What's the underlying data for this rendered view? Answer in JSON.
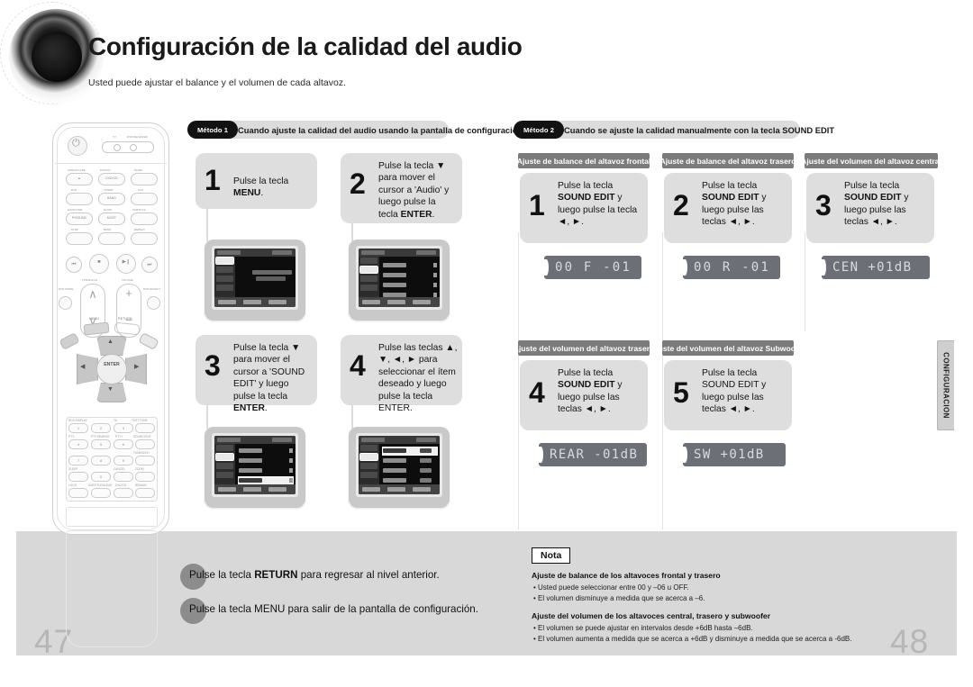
{
  "header": {
    "title": "Configuración de la calidad del audio",
    "subtitle": "Usted puede ajustar el balance y el volumen de cada altavoz.",
    "speaker_icon": "speaker-cone-icon"
  },
  "side_tab": {
    "label": "CONFIGURACION"
  },
  "pages": {
    "left": "47",
    "right": "48"
  },
  "method1": {
    "badge": "Método 1",
    "heading": "Cuando ajuste la calidad del audio usando la pantalla de configuración",
    "steps": [
      {
        "num": "1",
        "text_parts": [
          {
            "t": "Pulse la tecla ",
            "b": false
          },
          {
            "t": "MENU",
            "b": true
          },
          {
            "t": ".",
            "b": false
          }
        ]
      },
      {
        "num": "2",
        "text_parts": [
          {
            "t": "Pulse la tecla ▼ para mover el cursor a 'Audio' y luego pulse la tecla ",
            "b": false
          },
          {
            "t": "ENTER",
            "b": true
          },
          {
            "t": ".",
            "b": false
          }
        ]
      },
      {
        "num": "3",
        "text_parts": [
          {
            "t": "Pulse la tecla ▼ para mover el cursor a 'SOUND EDIT' y luego pulse la tecla ",
            "b": false
          },
          {
            "t": "ENTER",
            "b": true
          },
          {
            "t": ".",
            "b": false
          }
        ]
      },
      {
        "num": "4",
        "text_parts": [
          {
            "t": "Pulse las teclas ▲, ▼, ◄, ► para seleccionar el ítem deseado y luego pulse la tecla ENTER.",
            "b": false
          }
        ]
      }
    ]
  },
  "method2": {
    "badge": "Método 2",
    "heading": "Cuando se ajuste la calidad manualmente con la tecla SOUND EDIT",
    "columns": [
      {
        "header": "Ajuste de balance del altavoz frontal",
        "step_num": "1",
        "text_parts": [
          {
            "t": "Pulse la tecla ",
            "b": false
          },
          {
            "t": "SOUND EDIT",
            "b": true
          },
          {
            "t": " y luego pulse la tecla ◄, ►.",
            "b": false
          }
        ],
        "display": "00 F -01"
      },
      {
        "header": "Ajuste de balance del altavoz trasero",
        "step_num": "2",
        "text_parts": [
          {
            "t": "Pulse la tecla ",
            "b": false
          },
          {
            "t": "SOUND EDIT",
            "b": true
          },
          {
            "t": " y luego pulse las teclas ◄, ►.",
            "b": false
          }
        ],
        "display": "00 R -01"
      },
      {
        "header": "Ajuste  del volumen del altavoz central",
        "step_num": "3",
        "text_parts": [
          {
            "t": "Pulse la tecla ",
            "b": false
          },
          {
            "t": "SOUND EDIT",
            "b": true
          },
          {
            "t": " y luego pulse las teclas ◄, ►.",
            "b": false
          }
        ],
        "display": "CEN +01dB"
      },
      {
        "header": "Ajuste del volumen del altavoz trasero",
        "step_num": "4",
        "text_parts": [
          {
            "t": "Pulse la tecla ",
            "b": false
          },
          {
            "t": "SOUND EDIT",
            "b": true
          },
          {
            "t": " y luego pulse las teclas ◄, ►.",
            "b": false
          }
        ],
        "display": "REAR -01dB"
      },
      {
        "header": "Ajuste del volumen del altavoz Subwoofer",
        "step_num": "5",
        "text_parts": [
          {
            "t": "Pulse la tecla SOUND EDIT y luego pulse las teclas ◄, ►.",
            "b": false
          }
        ],
        "display": "SW  +01dB"
      }
    ]
  },
  "bottom_notes": [
    {
      "parts": [
        {
          "t": "Pulse la tecla ",
          "b": false
        },
        {
          "t": "RETURN",
          "b": true
        },
        {
          "t": " para regresar al nivel anterior.",
          "b": false
        }
      ]
    },
    {
      "parts": [
        {
          "t": "Pulse la tecla MENU para salir de la pantalla de configuración.",
          "b": false
        }
      ]
    }
  ],
  "nota": {
    "badge": "Nota",
    "groups": [
      {
        "heading": "Ajuste de balance de los altavoces frontal y trasero",
        "items": [
          "Usted puede seleccionar entre 00 y –06 u OFF.",
          "El volumen disminuye a medida que se acerca a –6."
        ]
      },
      {
        "heading": "Ajuste del volumen de los altavoces central, trasero y subwoofer",
        "items": [
          "El volumen se puede ajustar en intervalos desde +6dB hasta –6dB.",
          "El volumen aumenta a medida que se acerca a +6dB y disminuye a medida que se acerca a -6dB."
        ]
      }
    ]
  },
  "remote": {
    "name": "dvd-receiver-remote-control",
    "mode_labels": [
      "TV",
      "DVD RECEIVER"
    ],
    "buttons": [
      "OPEN/CLOSE",
      "DVD/CD",
      "MODE",
      "DVD",
      "TUNER",
      "AUX",
      "EQ/SOUND",
      "SLOW",
      "SUBTITLE",
      "STEP",
      "BAND",
      "REPEAT"
    ],
    "transport": [
      "⏮",
      "■",
      "▶❙",
      "⏭"
    ],
    "center": {
      "menu": "MENU",
      "return": "RETURN",
      "enter": "ENTER"
    },
    "keypad": [
      "1",
      "2",
      "3",
      "4",
      "5",
      "6",
      "7",
      "8",
      "9",
      "0"
    ],
    "keypad_labels": [
      "RDS DISPLAY",
      "TA",
      "TEST TONE",
      "PTY-",
      "PTY SEARCH",
      "PTY+",
      "SOUND EDIT",
      "TUNING/CH",
      "SLEEP",
      "CANCEL",
      "ZOOM",
      "LOGO",
      "SUBTITLE/AUDIO",
      "DVD/CD",
      "REMAIN"
    ],
    "vol_labels": [
      "TUNING/CH",
      "VOLUME"
    ],
    "extra": [
      "DVD MODE",
      "DVD EFFECT"
    ]
  },
  "colors": {
    "band": "#d8d8d8",
    "step_bg": "#dedede",
    "subheader_bg": "#7b7b7b",
    "badge_bg": "#121212",
    "led_bg": "#6d6f77",
    "led_text": "#d9dbe2",
    "page_number": "#b6b6b6"
  }
}
